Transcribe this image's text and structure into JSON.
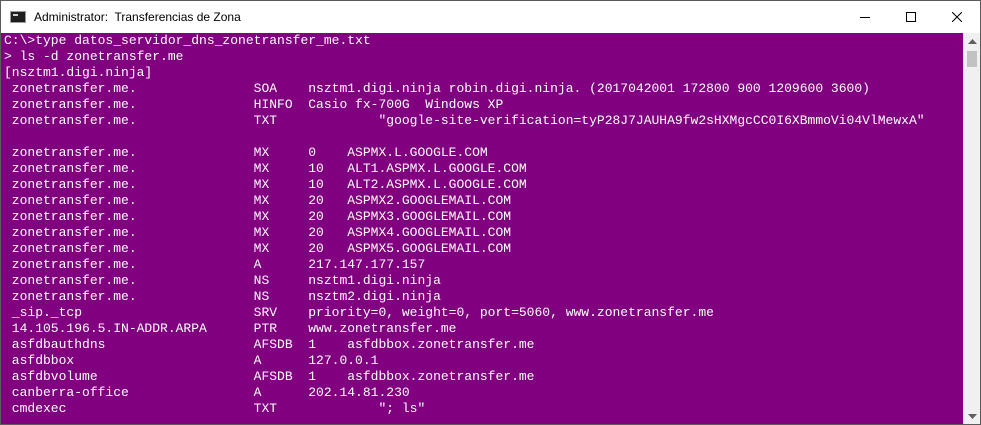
{
  "window": {
    "title": "Administrator:  Transferencias de Zona",
    "controls": {
      "minimize": "minimize-icon",
      "maximize": "maximize-icon",
      "close": "close-icon"
    }
  },
  "console": {
    "background": "#800080",
    "foreground": "#ffffff",
    "lines": [
      "C:\\>type datos_servidor_dns_zonetransfer_me.txt",
      "> ls -d zonetransfer.me",
      "[nsztm1.digi.ninja]",
      " zonetransfer.me.               SOA    nsztm1.digi.ninja robin.digi.ninja. (2017042001 172800 900 1209600 3600)",
      " zonetransfer.me.               HINFO  Casio fx-700G  Windows XP",
      " zonetransfer.me.               TXT             \"google-site-verification=tyP28J7JAUHA9fw2sHXMgcCC0I6XBmmoVi04VlMewxA\"",
      "",
      " zonetransfer.me.               MX     0    ASPMX.L.GOOGLE.COM",
      " zonetransfer.me.               MX     10   ALT1.ASPMX.L.GOOGLE.COM",
      " zonetransfer.me.               MX     10   ALT2.ASPMX.L.GOOGLE.COM",
      " zonetransfer.me.               MX     20   ASPMX2.GOOGLEMAIL.COM",
      " zonetransfer.me.               MX     20   ASPMX3.GOOGLEMAIL.COM",
      " zonetransfer.me.               MX     20   ASPMX4.GOOGLEMAIL.COM",
      " zonetransfer.me.               MX     20   ASPMX5.GOOGLEMAIL.COM",
      " zonetransfer.me.               A      217.147.177.157",
      " zonetransfer.me.               NS     nsztm1.digi.ninja",
      " zonetransfer.me.               NS     nsztm2.digi.ninja",
      " _sip._tcp                      SRV    priority=0, weight=0, port=5060, www.zonetransfer.me",
      " 14.105.196.5.IN-ADDR.ARPA      PTR    www.zonetransfer.me",
      " asfdbauthdns                   AFSDB  1    asfdbbox.zonetransfer.me",
      " asfdbbox                       A      127.0.0.1",
      " asfdbvolume                    AFSDB  1    asfdbbox.zonetransfer.me",
      " canberra-office                A      202.14.81.230",
      " cmdexec                        TXT             \"; ls\""
    ]
  },
  "scrollbar": {
    "up": "scroll-up-arrow-icon",
    "down": "scroll-down-arrow-icon",
    "position": 0
  }
}
